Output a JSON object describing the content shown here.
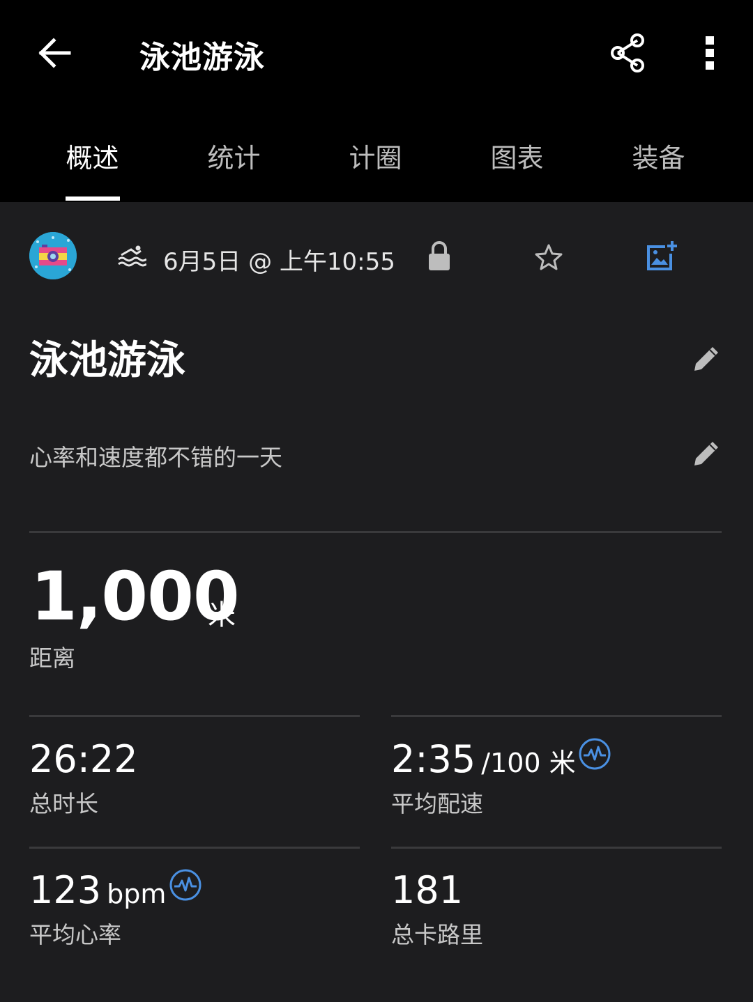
{
  "header": {
    "title": "泳池游泳",
    "back_icon": "arrow-left-icon",
    "share_icon": "share-icon",
    "more_icon": "more-vertical-icon"
  },
  "tabs": [
    {
      "label": "概述",
      "active": true
    },
    {
      "label": "统计",
      "active": false
    },
    {
      "label": "计圈",
      "active": false
    },
    {
      "label": "图表",
      "active": false
    },
    {
      "label": "装备",
      "active": false
    }
  ],
  "meta": {
    "avatar_icon": "camera-badge-icon",
    "activity_type_icon": "swim-icon",
    "datetime": "6月5日 @ 上午10:55",
    "privacy_icon": "lock-icon",
    "favorite_icon": "star-icon",
    "add_photo_icon": "add-photo-icon",
    "accent_color": "#4a90e2"
  },
  "activity": {
    "name": "泳池游泳",
    "description": "心率和速度都不错的一天"
  },
  "distance": {
    "value": "1,000",
    "unit": "米",
    "label": "距离"
  },
  "stats": {
    "duration": {
      "value": "26:22",
      "label": "总时长"
    },
    "pace": {
      "value": "2:35",
      "unit": "/100 米",
      "label": "平均配速"
    },
    "heart_rate": {
      "value": "123",
      "unit": "bpm",
      "label": "平均心率"
    },
    "calories": {
      "value": "181",
      "label": "总卡路里"
    }
  }
}
